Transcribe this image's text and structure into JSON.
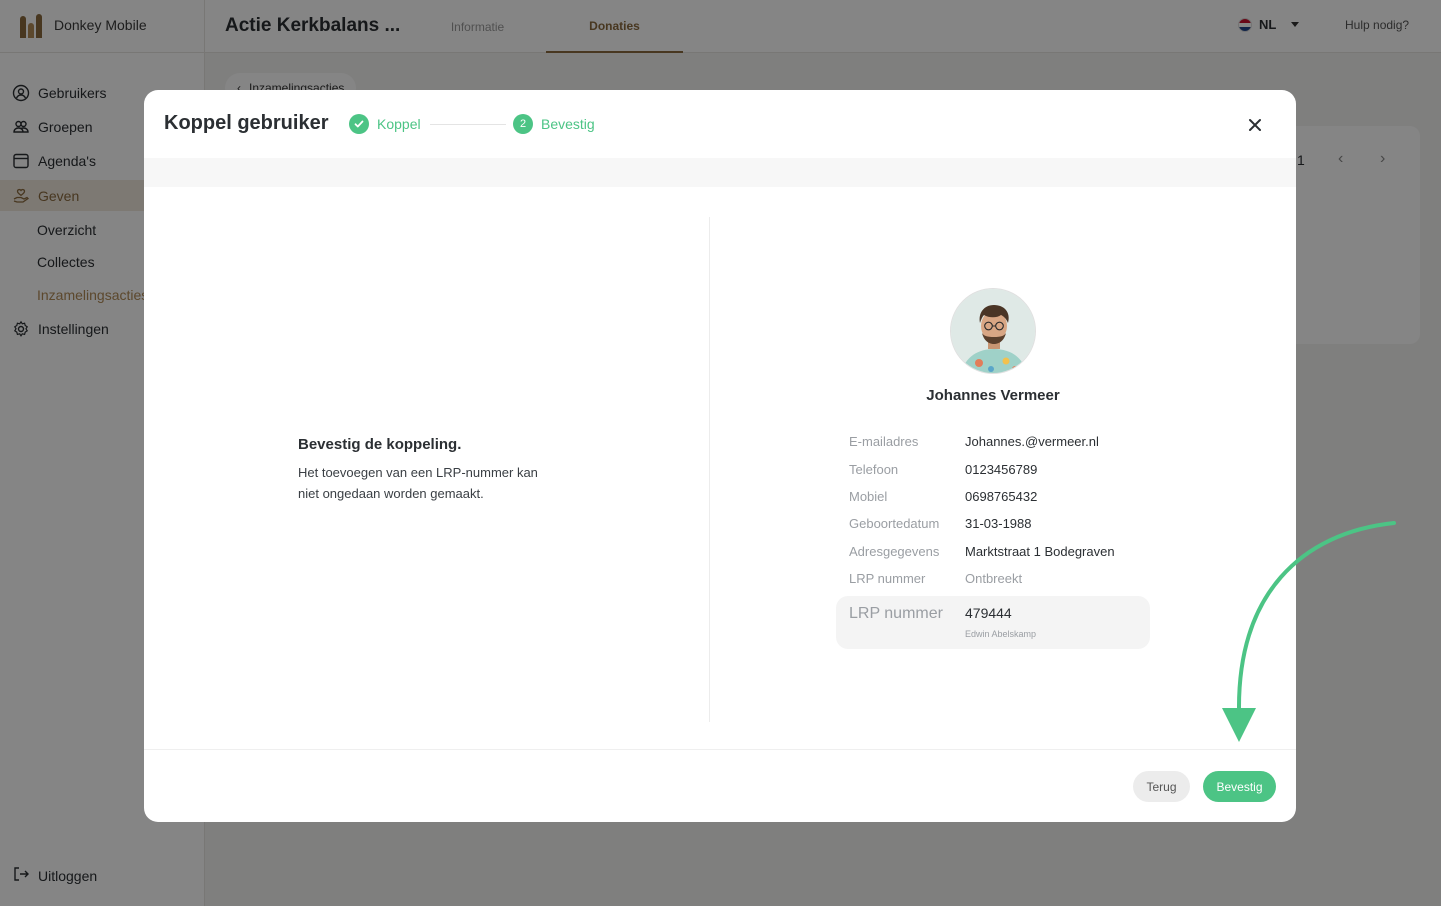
{
  "app": {
    "brand_name": "Donkey Mobile",
    "page_title": "Actie Kerkbalans ...",
    "tabs": [
      {
        "label": "Informatie",
        "active": false
      },
      {
        "label": "Donaties",
        "active": true
      }
    ],
    "language": "NL",
    "help_label": "Hulp nodig?",
    "accent_color": "#8a6a3f"
  },
  "sidebar": {
    "items": [
      {
        "label": "Gebruikers",
        "icon": "user-circle-icon"
      },
      {
        "label": "Groepen",
        "icon": "users-icon"
      },
      {
        "label": "Agenda's",
        "icon": "calendar-icon"
      },
      {
        "label": "Geven",
        "icon": "hand-heart-icon",
        "active": true
      },
      {
        "label": "Instellingen",
        "icon": "gear-icon"
      }
    ],
    "sub_items": [
      {
        "label": "Overzicht"
      },
      {
        "label": "Collectes"
      },
      {
        "label": "Inzamelingsacties",
        "active": true
      }
    ],
    "logout_label": "Uitloggen"
  },
  "background": {
    "breadcrumb": "Inzamelingsacties",
    "pager_page": "1"
  },
  "modal": {
    "title": "Koppel gebruiker",
    "steps": [
      {
        "number": "1",
        "label": "Koppel",
        "status": "done"
      },
      {
        "number": "2",
        "label": "Bevestig",
        "status": "current"
      }
    ],
    "confirm_heading": "Bevestig de koppeling.",
    "confirm_text": "Het toevoegen van een LRP-nummer kan niet ongedaan worden gemaakt.",
    "user": {
      "name": "Johannes Vermeer",
      "details": [
        {
          "label": "E-mailadres",
          "value": "Johannes.@vermeer.nl"
        },
        {
          "label": "Telefoon",
          "value": "0123456789"
        },
        {
          "label": "Mobiel",
          "value": "0698765432"
        },
        {
          "label": "Geboortedatum",
          "value": "31-03-1988"
        },
        {
          "label": "Adresgegevens",
          "value": "Marktstraat 1 Bodegraven"
        },
        {
          "label": "LRP nummer",
          "value": "Ontbreekt",
          "muted": true
        }
      ],
      "new_lrp": {
        "label": "LRP nummer",
        "value": "479444",
        "owner": "Edwin Abelskamp"
      }
    },
    "buttons": {
      "back_label": "Terug",
      "confirm_label": "Bevestig"
    },
    "success_color": "#4cc485"
  }
}
